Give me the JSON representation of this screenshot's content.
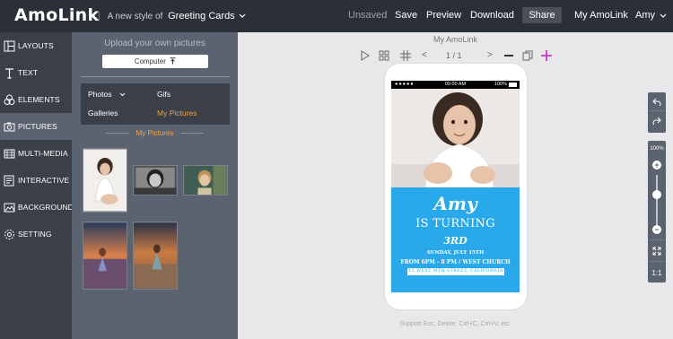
{
  "header": {
    "logo": "AmoLink",
    "separator": "|",
    "tagline": "A new style of",
    "card_type": "Greeting Cards",
    "unsaved": "Unsaved",
    "save": "Save",
    "preview": "Preview",
    "download": "Download",
    "share": "Share",
    "my_amolink": "My AmoLink",
    "user": "Amy"
  },
  "sidebar": {
    "items": [
      {
        "label": "LAYOUTS",
        "icon": "layouts-icon"
      },
      {
        "label": "TEXT",
        "icon": "text-icon"
      },
      {
        "label": "ELEMENTS",
        "icon": "elements-icon"
      },
      {
        "label": "PICTURES",
        "icon": "pictures-icon"
      },
      {
        "label": "MULTI-MEDIA",
        "icon": "multimedia-icon"
      },
      {
        "label": "INTERACTIVE",
        "icon": "interactive-icon"
      },
      {
        "label": "BACKGROUND",
        "icon": "background-icon"
      },
      {
        "label": "SETTING",
        "icon": "gear-icon"
      }
    ],
    "active_index": 3
  },
  "panel": {
    "upload_title": "Upload your own pictures",
    "computer_button": "Computer",
    "categories": {
      "photos": "Photos",
      "gifs": "Gifs",
      "galleries": "Galleries",
      "my_pictures": "My Pictures"
    },
    "section_label": "My Pictures"
  },
  "canvas": {
    "title": "My AmoLink",
    "page_indicator": "1  /  1",
    "support_text": "Support Esc, Delete, Ctrl+C, Ctrl+V, etc."
  },
  "card": {
    "status_time": "09:00 AM",
    "status_battery": "100%",
    "name": "Amy",
    "turning": "IS TURNING",
    "age": "3RD",
    "date": "SUNDAY, JULY 15TH",
    "time": "FROM 6PM - 8 PM / WEST CHURCH",
    "address": "12 WEST MTH STREET, CALIFORNIA"
  },
  "zoom": {
    "level_text": "100%",
    "level": 0.6,
    "ratio_label": "1:1"
  },
  "colors": {
    "accent_orange": "#f0a340",
    "card_blue": "#29a8ea",
    "topbar": "#2b2f37",
    "add_plus": "#cc33cc"
  }
}
